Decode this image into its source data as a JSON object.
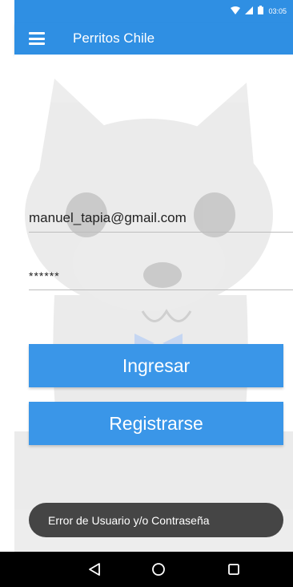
{
  "status_bar": {
    "time": "03:05",
    "icons": [
      "wifi-icon",
      "signal-icon",
      "battery-icon"
    ]
  },
  "toolbar": {
    "menu_icon": "menu-icon",
    "title": "Perritos Chile",
    "color": "#2f8fe3"
  },
  "login_form": {
    "email_value": "manuel_tapia@gmail.com",
    "password_value": "******",
    "login_label": "Ingresar",
    "register_label": "Registrarse",
    "button_color": "#3a96e8"
  },
  "toast": {
    "message": "Error de Usuario y/o Contraseña"
  },
  "nav_bar": {
    "icons": [
      "back-icon",
      "home-icon",
      "recents-icon"
    ]
  }
}
